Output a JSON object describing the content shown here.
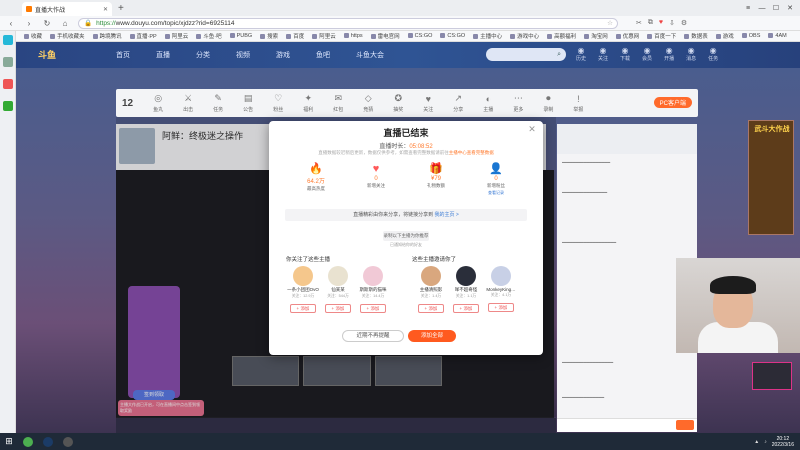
{
  "browser": {
    "tab_title": "直播大作战",
    "url_https": "https://",
    "url_rest": "www.douyu.com/topic/xjdzz?rid=6925114",
    "bookmarks": [
      "收藏",
      "手机收藏夹",
      "跨境腾讯",
      "直播·PP",
      "阿里云",
      "斗鱼·吧",
      "PUBG",
      "搜索",
      "百度",
      "阿里云",
      "https",
      "雷电官网",
      "CS:GO",
      "CS:GO",
      "主播中心",
      "游戏中心",
      "高额福利",
      "淘宝网",
      "优惠网",
      "百度一下",
      "数据表",
      "游戏",
      "OBS",
      "4AM"
    ]
  },
  "site": {
    "logo": "斗鱼",
    "nav": [
      "首页",
      "直播",
      "分类",
      "视频",
      "游戏",
      "鱼吧",
      "斗鱼大会"
    ],
    "header_icons": [
      {
        "icon": "history",
        "label": "历史"
      },
      {
        "icon": "follow",
        "label": "关注"
      },
      {
        "icon": "download",
        "label": "下载"
      },
      {
        "icon": "vip",
        "label": "会员"
      },
      {
        "icon": "live",
        "label": "开播"
      },
      {
        "icon": "msg",
        "label": "消息"
      },
      {
        "icon": "task",
        "label": "任务"
      }
    ]
  },
  "toolbar": {
    "level": "12",
    "items": [
      "鱼丸",
      "出击",
      "任务",
      "公告",
      "粉丝",
      "福利",
      "红包",
      "竞猜",
      "抽奖",
      "关注",
      "分享",
      "主播",
      "更多",
      "录制",
      "举报"
    ],
    "pc_button": "PC客户端"
  },
  "streamer": {
    "title": "阿鲜：终极迷之操作"
  },
  "modal": {
    "title": "直播已结束",
    "duration_label": "直播时长：",
    "duration_value": "05:08:52",
    "note": "直播数据较迟稍后更新，数据仅供参考，如需查看完整数据请前往",
    "note_link": "主播中心查看完整数据",
    "stats": [
      {
        "icon": "🔥",
        "value": "64.2万",
        "label": "最高热度",
        "color": "#ff6a2b"
      },
      {
        "icon": "♥",
        "value": "0",
        "label": "新增关注",
        "color": "#ff5a5a"
      },
      {
        "icon": "🎁",
        "value": "¥79",
        "label": "礼物数额",
        "color": "#ff5a3a"
      },
      {
        "icon": "👤",
        "value": "0",
        "label": "新增粉丝",
        "sub": "查看记录",
        "color": "#ff7a2e"
      }
    ],
    "share_text": "直播精彩由你来分享，将链接分享到",
    "share_link": "我的主页 >",
    "record_button": "录制以下主播为你推荐",
    "record_sub": "已通知给你的好友",
    "left_title": "你关注了这些主播",
    "right_title": "这些主播邀请你了",
    "left_users": [
      {
        "name": "一条小团团OvO",
        "fans": "关注：12.9万",
        "color": "#f5c78c"
      },
      {
        "name": "仙某某",
        "fans": "关注：544万",
        "color": "#e9e2d0"
      },
      {
        "name": "斯斯斯的猫咪",
        "fans": "关注：14.4万",
        "color": "#f1c9d6"
      }
    ],
    "right_users": [
      {
        "name": "主播清照影",
        "fans": "关注：1.4万",
        "color": "#d9a77e"
      },
      {
        "name": "咩不超奇怪",
        "fans": "关注：1.1万",
        "color": "#2a2e3a"
      },
      {
        "name": "MonkeyKing…",
        "fans": "关注：4.1万",
        "color": "#c8d0e6"
      }
    ],
    "add_label": "添加",
    "btn_dismiss": "近期不再提醒",
    "btn_follow_all": "添加全部"
  },
  "promo": {
    "button": "签到领取",
    "tip": "主播大作战已开启，可在直播间中点击签到领取奖励"
  },
  "side_ad": {
    "text": "武斗大作战"
  },
  "taskbar": {
    "time": "20:12",
    "date": "2022/3/16"
  }
}
